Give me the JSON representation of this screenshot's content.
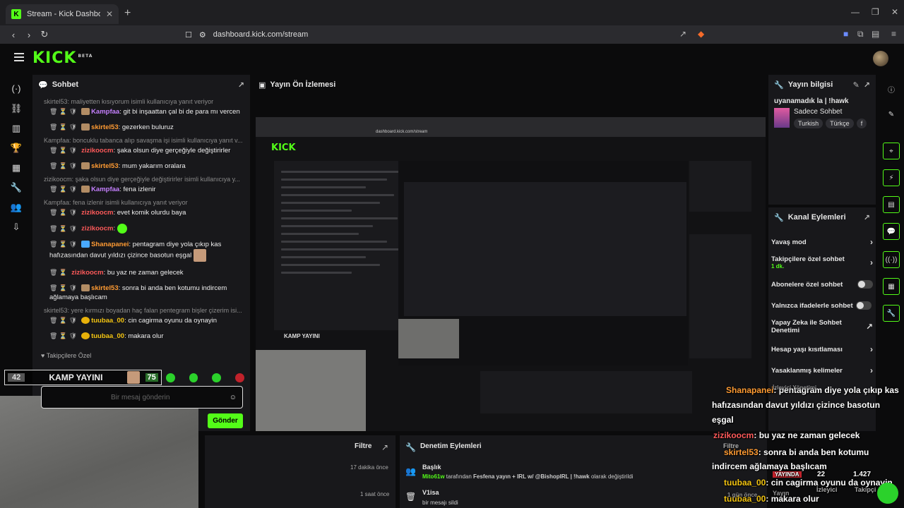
{
  "browser": {
    "tab_title": "Stream - Kick Dashboard",
    "url": "dashboard.kick.com/stream"
  },
  "header": {
    "logo": "KICK",
    "beta": "BETA"
  },
  "chat": {
    "title": "Sohbet",
    "messages": [
      {
        "reply": "skirtel53: maliyetten kısıyorum isimli kullanıcıya yanıt veriyor",
        "user": "Kampfaa",
        "text": ": git bi inşaattan çal bi de para mı vercen"
      },
      {
        "user": "skirtel53",
        "text": ": gezerken buluruz"
      },
      {
        "reply": "Kampfaa: boncuklu tabanca alıp savaşma işi isimli kullanıcıya yanıt v...",
        "user": "zizikoocm",
        "text": ": şaka olsun diye gerçeğiyle değiştirirler"
      },
      {
        "user": "skirtel53",
        "text": ": mum yakarım oralara"
      },
      {
        "reply": "zizikoocm: şaka olsun diye gerçeğiyle değiştirirler isimli kullanıcıya y...",
        "user": "Kampfaa",
        "text": ": fena izlenir"
      },
      {
        "reply": "Kampfaa: fena izlenir isimli kullanıcıya yanıt veriyor",
        "user": "zizikoocm",
        "text": ": evet komik olurdu baya"
      },
      {
        "user": "zizikoocm",
        "text": ":"
      },
      {
        "user": "Shanapanei",
        "text": ": pentagram diye yola çıkıp kas hafızasından davut yıldızı çizince basotun eşgal"
      },
      {
        "user": "zizikoocm",
        "text": ": bu yaz ne zaman gelecek"
      },
      {
        "user": "skirtel53",
        "text": ": sonra bi anda ben kotumu indircem ağlamaya başlıcam"
      },
      {
        "reply": "skirtel53: yere kırmızı boyadan haç falan pentegram bişler çizerim isi...",
        "user": "tuubaa_00",
        "text": ": cin cagirma oyunu da oynayin"
      },
      {
        "user": "tuubaa_00",
        "text": ": makara olur"
      }
    ],
    "followers_only": "Takipçilere Özel",
    "input_placeholder": "Bir mesaj gönderin",
    "send_label": "Gönder"
  },
  "overlay": {
    "viewer_count": "42",
    "stream_title": "KAMP YAYINI",
    "score": "75"
  },
  "preview": {
    "title": "Yayın Ön İzlemesi",
    "mini_url": "dashboard.kick.com/stream",
    "mini_stream_title": "KAMP YAYINI"
  },
  "stream_info": {
    "title": "Yayın bilgisi",
    "stream_name": "uyanamadık la | !hawk",
    "category": "Sadece Sohbet",
    "tags": [
      "Turkish",
      "Türkçe",
      "f"
    ]
  },
  "channel_actions": {
    "title": "Kanal Eylemleri",
    "items": [
      {
        "label": "Yavaş mod",
        "kind": "arrow"
      },
      {
        "label": "Takipçilere özel sohbet",
        "sub": "1 dk.",
        "kind": "arrow"
      },
      {
        "label": "Abonelere özel sohbet",
        "kind": "toggle"
      },
      {
        "label": "Yalnızca ifadelerle sohbet",
        "kind": "toggle"
      },
      {
        "label": "Yapay Zeka ile Sohbet Denetimi",
        "kind": "external"
      },
      {
        "label": "Hesap yaşı kısıtlaması",
        "kind": "arrow"
      },
      {
        "label": "Yasaklanmış kelimeler",
        "kind": "arrow"
      }
    ]
  },
  "filter_panel": {
    "title": "Filtre",
    "rows": [
      {
        "time": "17 dakika önce"
      },
      {
        "time": "1 saat önce"
      }
    ]
  },
  "moderation": {
    "title": "Denetim Eylemleri",
    "rows": [
      {
        "title": "Başlık",
        "actor": "Mito61w",
        "mid": " tarafından ",
        "value": "Fesfena yayın + IRL w/ @BishopIRL | !hawk",
        "tail": " olarak değiştirildi"
      },
      {
        "title": "V1isa",
        "detail": "bir mesajı sildi"
      }
    ]
  },
  "big_overlay": {
    "lines": [
      {
        "user": "Shanapanei",
        "text": ": pentagram diye yola çıkıp kas"
      },
      {
        "text": "hafızasından davut yıldızı çizince basotun"
      },
      {
        "text": "eşgal"
      },
      {
        "user": "zizikoocm",
        "text": ": bu yaz ne zaman gelecek"
      },
      {
        "user": "skirtel53",
        "text": ": sonra bi anda ben kotumu"
      },
      {
        "text": "indircem ağlamaya başlıcam"
      },
      {
        "user": "tuubaa_00",
        "text": ": cin cagirma oyunu da oynayin"
      },
      {
        "user": "tuubaa_00",
        "text": ": makara olur"
      }
    ],
    "stats": {
      "live": "YAYINDA",
      "viewers": "22",
      "viewers_label": "İzleyici",
      "followers": "1.427",
      "followers_label": "Takipçi"
    },
    "ghost": {
      "filter": "Filtre",
      "time": "1 gün önce",
      "yayin": "Yayın",
      "izleyici_yonetimi": "İzleyici Yönetimi"
    }
  },
  "colors": {
    "accent": "#53fc18",
    "panel": "#18181b",
    "bg": "#0b0b0c"
  }
}
